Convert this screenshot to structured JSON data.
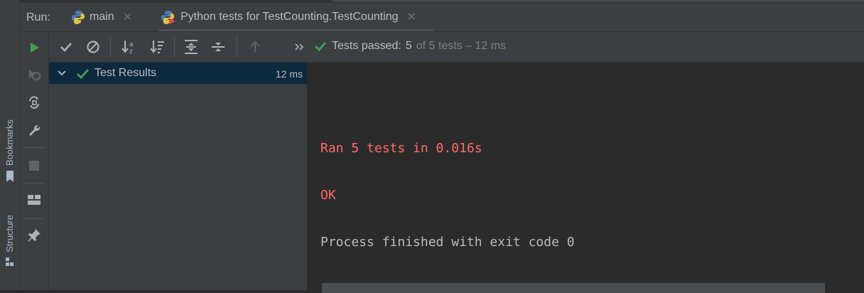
{
  "side_strip": {
    "bookmarks_label": "Bookmarks",
    "structure_label": "Structure"
  },
  "tabbar": {
    "run_label": "Run:",
    "tabs": [
      {
        "label": "main",
        "icon": "python-icon",
        "active": false
      },
      {
        "label": "Python tests for TestCounting.TestCounting",
        "icon": "python-test-icon",
        "active": true
      }
    ]
  },
  "left_toolbar": {
    "icons": [
      "rerun-icon",
      "rerun-failed-icon",
      "toggle-auto-test-icon",
      "settings-wrench-icon",
      "stop-icon",
      "layout-icon",
      "pin-icon"
    ]
  },
  "test_toolbar": {
    "icons": [
      "show-passed-icon",
      "show-ignored-icon",
      "sort-alphabetically-icon",
      "sort-by-duration-icon",
      "expand-all-icon",
      "collapse-all-icon",
      "previous-failed-icon",
      "more-icon"
    ],
    "status": {
      "passed_prefix": "Tests passed:",
      "passed_count": "5",
      "of_total": "of 5 tests – 12 ms"
    }
  },
  "results": {
    "root_label": "Test Results",
    "root_time": "12 ms"
  },
  "console": {
    "lines": [
      "Ran 5 tests in 0.016s",
      "OK",
      "Process finished with exit code 0"
    ]
  },
  "colors": {
    "accent_green": "#499c54",
    "error_red": "#ff6b68",
    "selection_bg": "#0d293e"
  }
}
